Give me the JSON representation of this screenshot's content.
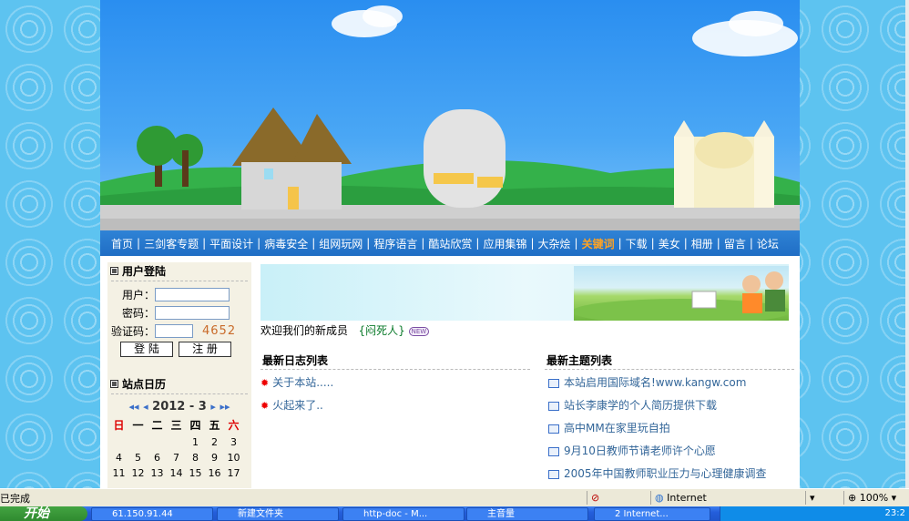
{
  "nav": [
    "首页",
    "三剑客专题",
    "平面设计",
    "病毒安全",
    "组网玩网",
    "程序语言",
    "酷站欣赏",
    "应用集锦",
    "大杂烩",
    "关键词",
    "下载",
    "美女",
    "相册",
    "留言",
    "论坛"
  ],
  "nav_highlight": "关键词",
  "login": {
    "title": "用户登陆",
    "user_label": "用户：",
    "pass_label": "密码：",
    "code_label": "验证码：",
    "captcha": "4652",
    "login_button": "登 陆",
    "register_button": "注 册"
  },
  "calendar": {
    "title": "站点日历",
    "month_label": "2012 - 3",
    "prev_year": "◂◂",
    "prev_month": "◂",
    "next_month": "▸",
    "next_year": "▸▸",
    "weekdays": [
      "日",
      "一",
      "二",
      "三",
      "四",
      "五",
      "六"
    ],
    "rows": [
      [
        "",
        "",
        "",
        "",
        "1",
        "2",
        "3"
      ],
      [
        "4",
        "5",
        "6",
        "7",
        "8",
        "9",
        "10"
      ],
      [
        "11",
        "12",
        "13",
        "14",
        "15",
        "16",
        "17"
      ]
    ]
  },
  "welcome": {
    "text": "欢迎我们的新成员",
    "member": "{闷死人}",
    "badge": "NEW"
  },
  "logs": {
    "title": "最新日志列表",
    "items": [
      "关于本站.....",
      "火起来了.."
    ]
  },
  "topics": {
    "title": "最新主题列表",
    "items": [
      "本站启用国际域名!www.kangw.com",
      "站长李康学的个人简历提供下载",
      "高中MM在家里玩自拍",
      "9月10日教师节请老师许个心愿",
      "2005年中国教师职业压力与心理健康调查"
    ]
  },
  "statusbar": {
    "left": "已完成",
    "zone": "Internet",
    "zoom": "100%"
  },
  "taskbar": {
    "start": "开始",
    "tasks": [
      "61.150.91.44",
      "新建文件夹",
      "http-doc - M...",
      "主音量",
      "2 Internet..."
    ],
    "clock": "23:2"
  },
  "colors": {
    "nav_bg": "#2277cc",
    "nav_highlight": "#ffa323",
    "link": "#336699"
  }
}
